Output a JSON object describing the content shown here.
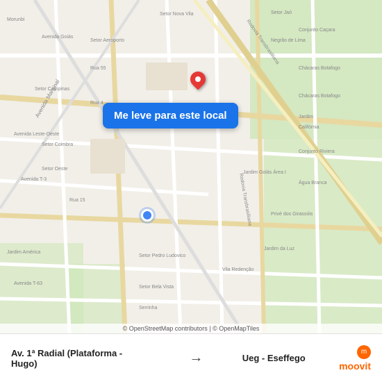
{
  "map": {
    "callout_text": "Me leve para este local",
    "attribution": "© OpenStreetMap contributors | © OpenMapTiles"
  },
  "bottom_bar": {
    "from_label": "",
    "from_name": "Av. 1ª Radial (Plataforma - Hugo)",
    "arrow": "→",
    "to_label": "",
    "to_name": "Ueg - Eseffego",
    "brand": "moovit"
  }
}
